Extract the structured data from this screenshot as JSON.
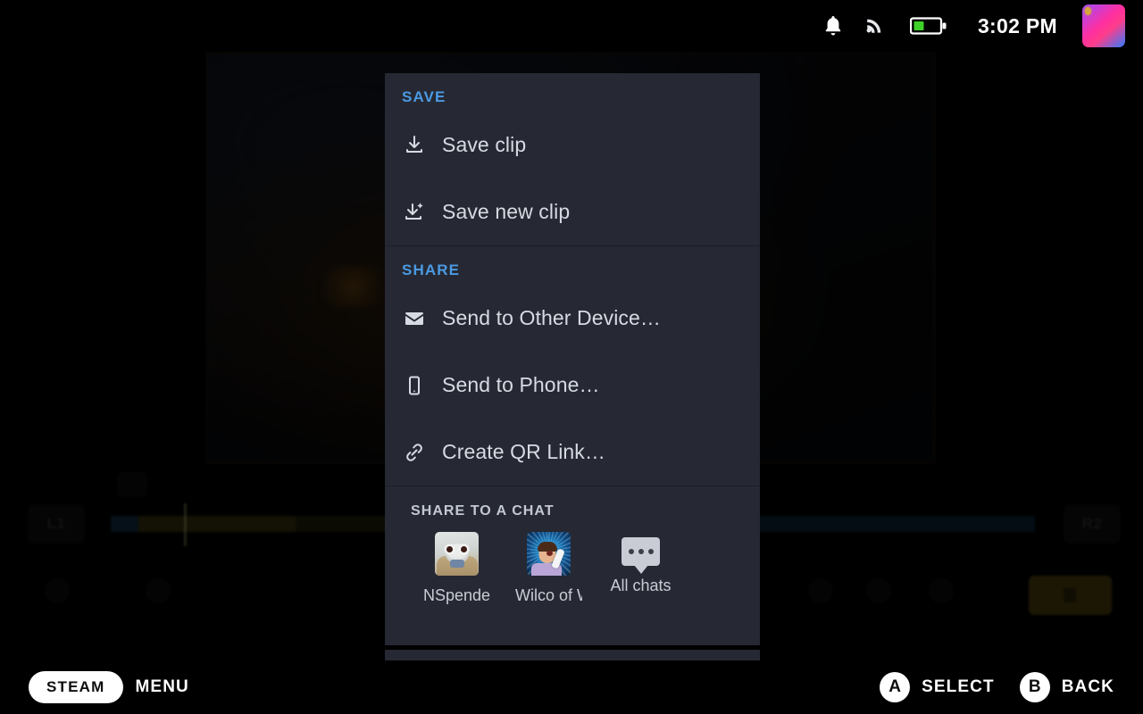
{
  "statusbar": {
    "notification_icon": "bell-icon",
    "wifi_icon": "wifi-icon",
    "battery_icon": "battery-icon",
    "battery_level_pct": 40,
    "time": "3:02 PM",
    "avatar_icon": "user-avatar",
    "avatar_border_colors": [
      "#9d4bff",
      "#ff2fa0",
      "#2f7bff"
    ]
  },
  "menu": {
    "accent_color": "#4b9ae4",
    "panel_bg": "#262933",
    "groups": [
      {
        "header": "SAVE",
        "items": [
          {
            "label": "Save clip",
            "icon": "save-clip-icon"
          },
          {
            "label": "Save new clip",
            "icon": "save-new-clip-icon"
          }
        ]
      },
      {
        "header": "SHARE",
        "items": [
          {
            "label": "Send to Other Device…",
            "icon": "envelope-icon"
          },
          {
            "label": "Send to Phone…",
            "icon": "phone-icon"
          },
          {
            "label": "Create QR Link…",
            "icon": "link-icon"
          }
        ]
      }
    ],
    "chat_section": {
      "header": "SHARE TO A CHAT",
      "items": [
        {
          "label": "NSpender",
          "avatar": "lemur-avatar"
        },
        {
          "label": "Wilco of Wa",
          "avatar": "wilco-avatar"
        },
        {
          "label": "All chats",
          "avatar": "all-chats-bubble-icon"
        }
      ]
    }
  },
  "bottombar": {
    "steam_label": "STEAM",
    "menu_label": "MENU",
    "hints": [
      {
        "button": "A",
        "label": "SELECT"
      },
      {
        "button": "B",
        "label": "BACK"
      }
    ]
  },
  "background": {
    "shoulder_left": "L1",
    "shoulder_right": "R2"
  }
}
